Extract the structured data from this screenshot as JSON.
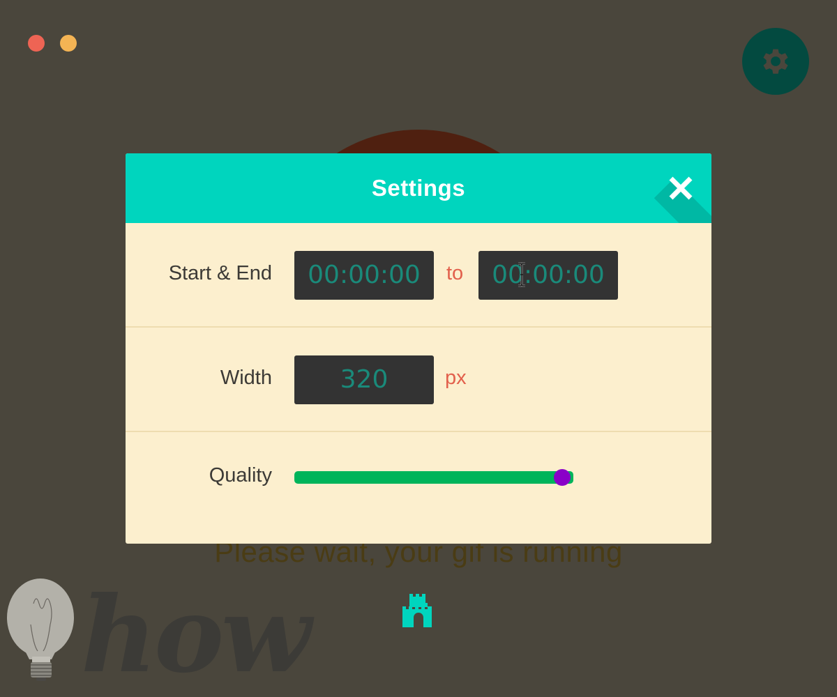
{
  "window": {
    "controls": [
      {
        "name": "close",
        "color": "#ee6454"
      },
      {
        "name": "minimize",
        "color": "#f4b454"
      }
    ]
  },
  "toolbar": {
    "settings_icon": "gear-icon"
  },
  "status": {
    "message": "Please wait, your gif is running",
    "icon": "castle-icon"
  },
  "watermark": {
    "text": "how",
    "icon": "lightbulb-icon"
  },
  "settings_dialog": {
    "title": "Settings",
    "close_icon": "close-icon",
    "start_end": {
      "label": "Start & End",
      "start_value": "00:00:00",
      "separator": "to",
      "end_value": "00:00:00"
    },
    "width": {
      "label": "Width",
      "value": "320",
      "unit": "px"
    },
    "quality": {
      "label": "Quality",
      "value_fraction": 0.96
    }
  },
  "colors": {
    "background": "#4a463c",
    "header": "#00d5be",
    "body": "#fcefce",
    "input_bg": "#333333",
    "input_text": "#1a8a7a",
    "accent_text": "#e2604c",
    "slider_track": "#00b45a",
    "slider_thumb": "#8a00c8",
    "settings_button": "#034a40"
  }
}
